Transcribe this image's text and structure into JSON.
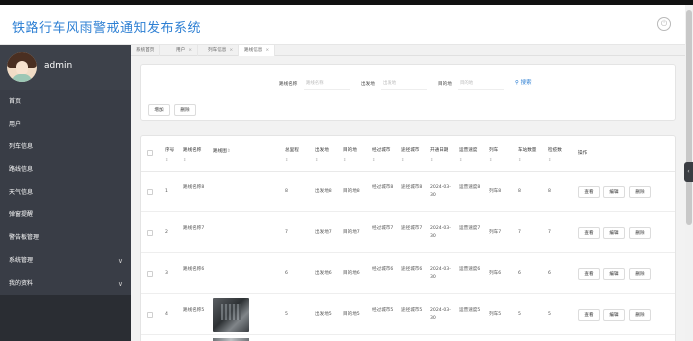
{
  "app": {
    "title": "铁路行车风雨警戒通知发布系统"
  },
  "user": {
    "name": "admin"
  },
  "sidebar": {
    "items": [
      {
        "label": "首页",
        "chevron": ""
      },
      {
        "label": "用户",
        "chevron": ""
      },
      {
        "label": "列车信息",
        "chevron": ""
      },
      {
        "label": "路线信息",
        "chevron": ""
      },
      {
        "label": "天气信息",
        "chevron": ""
      },
      {
        "label": "弹窗提醒",
        "chevron": ""
      },
      {
        "label": "警告板管理",
        "chevron": ""
      },
      {
        "label": "系统管理",
        "chevron": "∨"
      },
      {
        "label": "我的资料",
        "chevron": "∨"
      }
    ]
  },
  "tabs": [
    {
      "label": "系统首页",
      "close": ""
    },
    {
      "label": "用户",
      "close": "×"
    },
    {
      "label": "列车信息",
      "close": "×"
    },
    {
      "label": "路线信息",
      "close": "×"
    }
  ],
  "search": {
    "fields": [
      {
        "label": "路线名称",
        "placeholder": "路线名称"
      },
      {
        "label": "出发地",
        "placeholder": "出发地"
      },
      {
        "label": "目的地",
        "placeholder": "目的地"
      }
    ],
    "search_label": "搜索",
    "search_icon": "search-icon"
  },
  "toolbar": {
    "add_label": "增加",
    "delete_label": "删除"
  },
  "table": {
    "headers": {
      "index": "序号",
      "route_name": "路线名称",
      "route_image": "路线图",
      "total_distance": "总里程",
      "departure": "出发地",
      "destination": "目的地",
      "via_city": "经过城市",
      "via_city2": "途径城市",
      "open_date": "开通日期",
      "speed": "运营速度",
      "train": "列车",
      "cars": "车站数量",
      "stations": "检疫数",
      "actions": "操作"
    },
    "sort_glyph": "⇕",
    "rows": [
      {
        "index": "1",
        "route_name": "路线名称8",
        "distance": "8",
        "departure": "出发地8",
        "destination": "目的地8",
        "via": "经过城市8",
        "via2": "途径城市8",
        "date": "2024-03-30",
        "speed": "运营速度8",
        "train": "列车8",
        "cars": "8",
        "stations": "8",
        "image": false
      },
      {
        "index": "2",
        "route_name": "路线名称7",
        "distance": "7",
        "departure": "出发地7",
        "destination": "目的地7",
        "via": "经过城市7",
        "via2": "途径城市7",
        "date": "2024-03-30",
        "speed": "运营速度7",
        "train": "列车7",
        "cars": "7",
        "stations": "7",
        "image": false
      },
      {
        "index": "3",
        "route_name": "路线名称6",
        "distance": "6",
        "departure": "出发地6",
        "destination": "目的地6",
        "via": "经过城市6",
        "via2": "途径城市6",
        "date": "2024-03-30",
        "speed": "运营速度6",
        "train": "列车6",
        "cars": "6",
        "stations": "6",
        "image": false
      },
      {
        "index": "4",
        "route_name": "路线名称5",
        "distance": "5",
        "departure": "出发地5",
        "destination": "目的地5",
        "via": "经过城市5",
        "via2": "途径城市5",
        "date": "2024-03-30",
        "speed": "运营速度5",
        "train": "列车5",
        "cars": "5",
        "stations": "5",
        "image": true
      }
    ],
    "action_labels": {
      "view": "查看",
      "edit": "编辑",
      "delete": "删除"
    }
  }
}
